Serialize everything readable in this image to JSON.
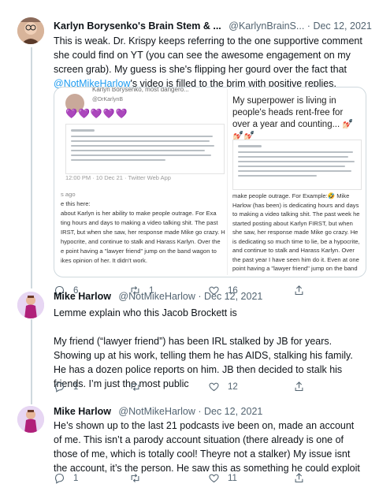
{
  "tweets": [
    {
      "name": "Karlyn Borysenko's Brain Stem & ...",
      "handle": "@KarlynBrainS...",
      "date": "Dec 12, 2021",
      "text_1": "This is weak. Dr. Krispy keeps referring to the one supportive comment she could find on YT (you can see the awesome engagement on my screen grab). My guess is she's flipping her gourd over the fact that ",
      "mention": "@NotMikeHarlow",
      "text_2": "'s video is filled to the brim with positive replies.",
      "replies": "6",
      "retweets": "1",
      "likes": "16"
    },
    {
      "name": "Mike Harlow",
      "handle": "@NotMikeHarlow",
      "date": "Dec 12, 2021",
      "paragraph_1": "Lemme explain who this Jacob Brockett is",
      "paragraph_2": "My friend (“lawyer friend”) has been IRL stalked by JB for years. Showing up at his work, telling them he has AIDS, stalking his family. He has a dozen police reports on him. JB then decided to stalk his friends. I’m just the most public",
      "replies": "1",
      "retweets": "",
      "likes": "12"
    },
    {
      "name": "Mike Harlow",
      "handle": "@NotMikeHarlow",
      "date": "Dec 12, 2021",
      "paragraph_1": "He’s shown up to the last 21 podcasts ive been on, made an account of me. This isn’t a parody account situation (there already is one of those of me, which is totally cool! Theyre not a stalker) My issue isnt the account, it’s the person. He saw this as something he could exploit",
      "replies": "1",
      "retweets": "",
      "likes": "11"
    }
  ],
  "attached": {
    "left": {
      "header_name": "Karlyn Borysenko, most dangero...",
      "header_handle": "@DrKarlynB",
      "hearts": "💜💜💜💜💜",
      "footer": "12:00 PM · 10 Dec 21 · Twitter Web App",
      "crop_label": "s ago",
      "crop_line_0": "e this here:",
      "crop_lines": [
        "about Karlyn is her ability to make people outrage. For Exa",
        "ting hours and days to making a video talking shit. The past",
        "IRST, but when she saw, her response made Mike go crazy. H",
        "hypocrite, and continue to stalk and Harass Karlyn. Over the",
        "e point having a \"lawyer friend\" jump on the band wagon to",
        "ikes opinion of her. It didn't work."
      ]
    },
    "right": {
      "caption": "My superpower is living in people's heads rent-free for over a year and counting... 💅🏻💅🏻💅🏻",
      "body": "make people outrage. For Example:🤣 Mike Harlow (has been) is dedicating hours and days to making a video talking shit. The past week he started posting about Karlyn FIRST, but when she saw, her response made Mike go crazy. He is dedicating so much time to lie, be a hypocrite, and continue to stalk and Harass Karlyn. Over the past year I have seen him do it. Even at one point having a \"lawyer friend\" jump on the band wagon to scare Karlyn into"
    }
  },
  "colors": {
    "text": "#0f1419",
    "muted": "#536471",
    "link": "#1d9bf0",
    "thread_line": "#cfd9de"
  }
}
